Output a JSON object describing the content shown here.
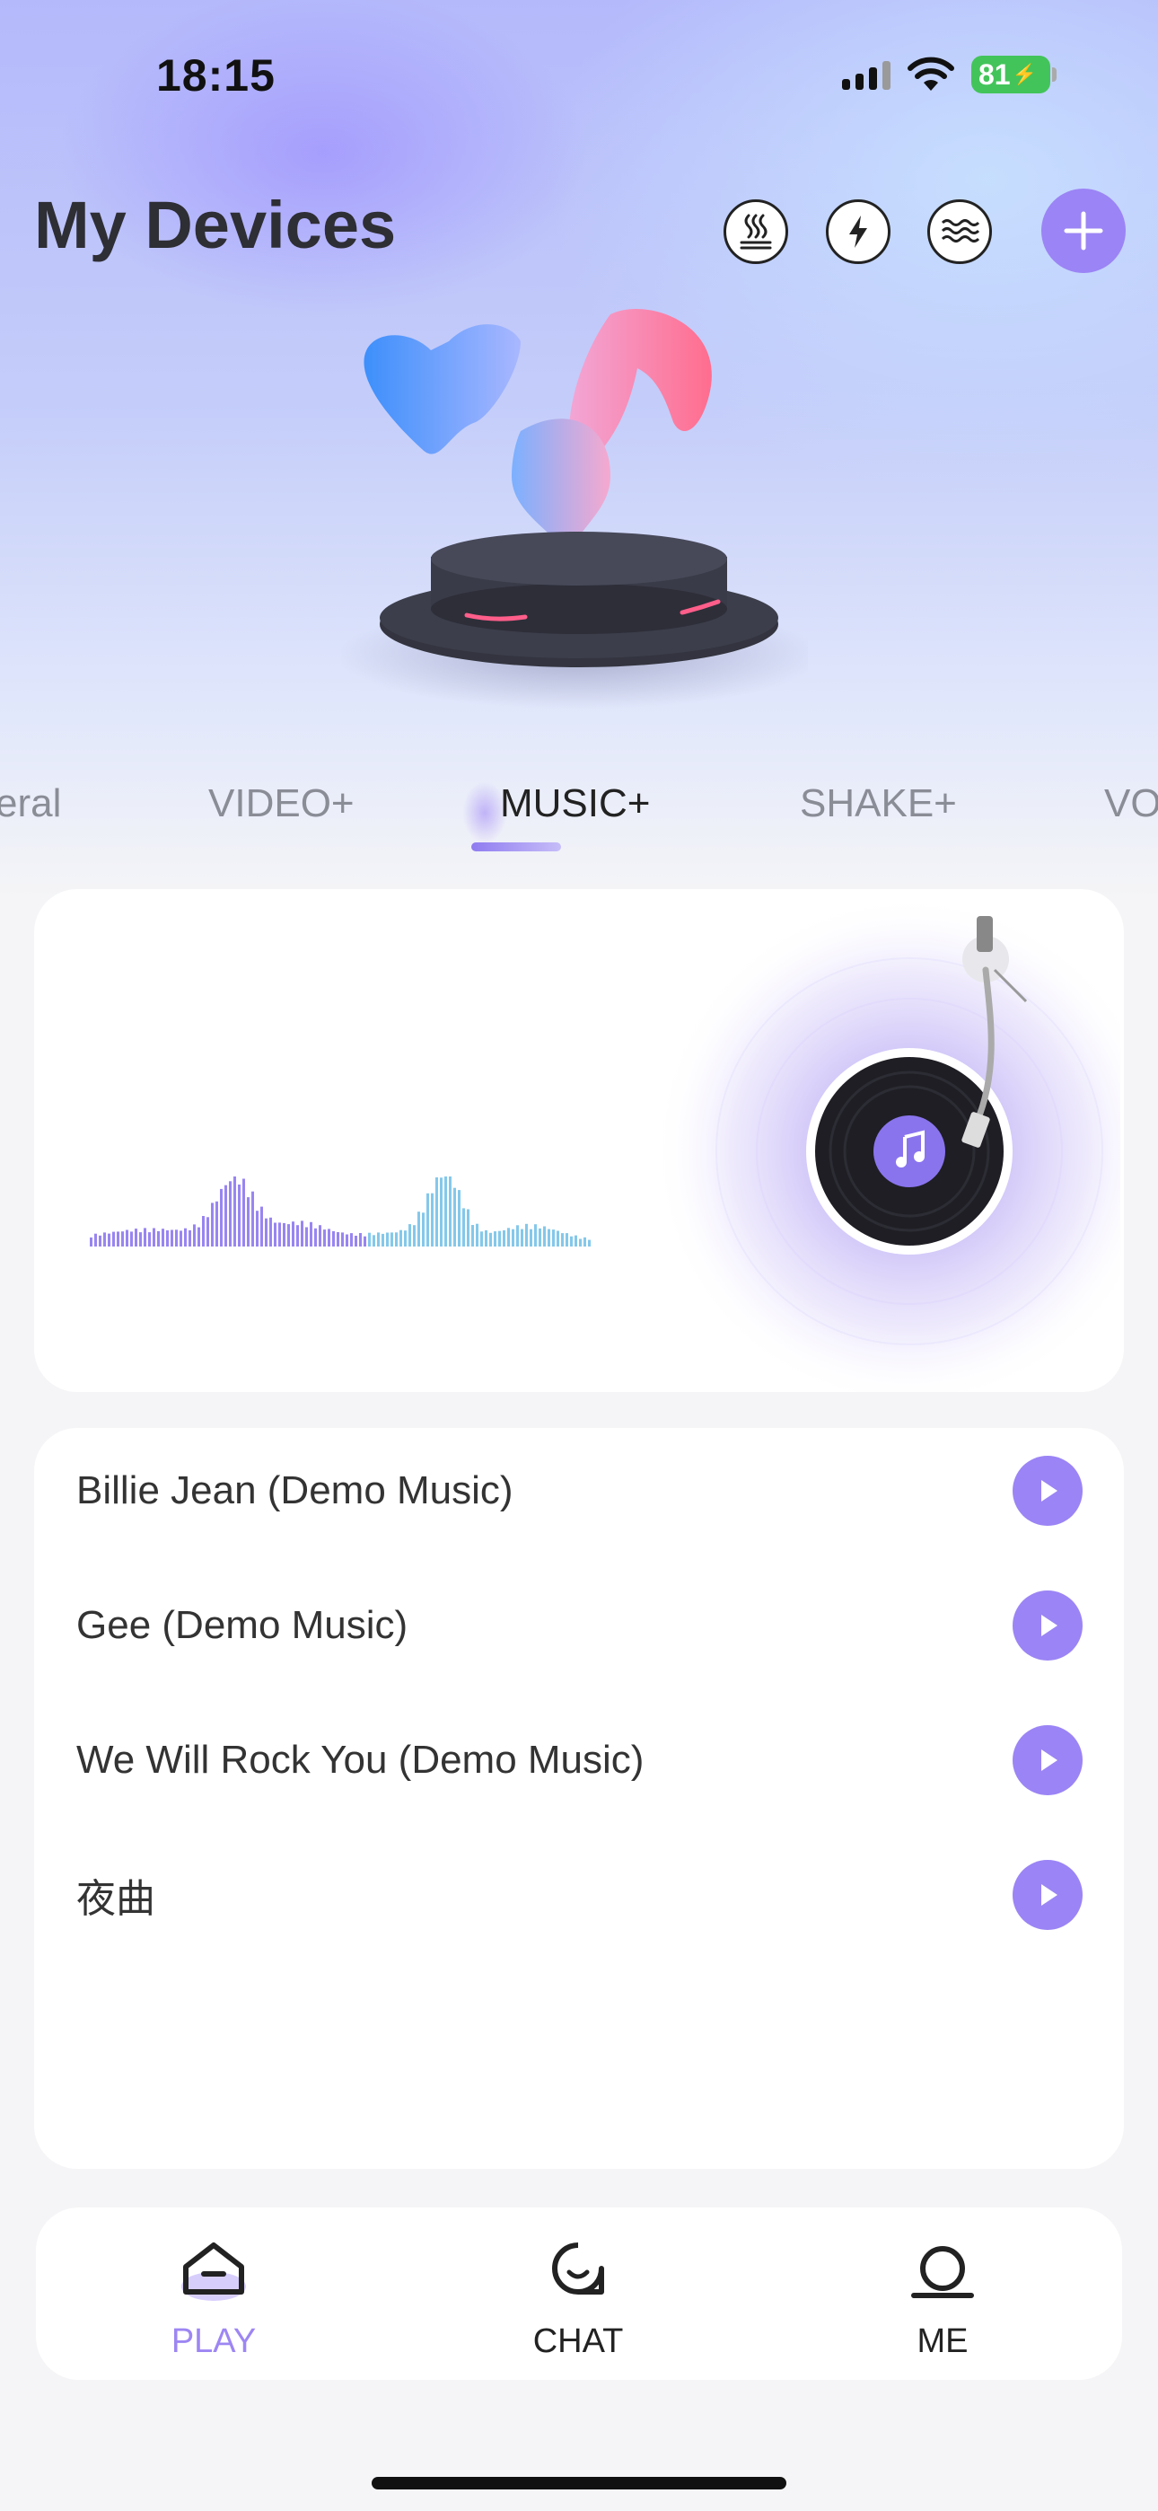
{
  "status_bar": {
    "time": "18:15",
    "battery": "81"
  },
  "header": {
    "title": "My Devices",
    "mode_icons": [
      "heat-icon",
      "lightning-icon",
      "waves-icon"
    ],
    "add_icon": "plus-icon"
  },
  "tabs": [
    {
      "label": "eral",
      "active": false
    },
    {
      "label": "VIDEO+",
      "active": false
    },
    {
      "label": "MUSIC+",
      "active": true
    },
    {
      "label": "SHAKE+",
      "active": false
    },
    {
      "label": "VO",
      "active": false
    }
  ],
  "songs": [
    {
      "title": "Billie Jean (Demo Music)"
    },
    {
      "title": "Gee (Demo Music)"
    },
    {
      "title": "We Will Rock You (Demo Music)"
    },
    {
      "title": "夜曲"
    }
  ],
  "bottom_nav": [
    {
      "label": "PLAY",
      "icon": "play-home-icon",
      "active": true
    },
    {
      "label": "CHAT",
      "icon": "chat-icon",
      "active": false
    },
    {
      "label": "ME",
      "icon": "profile-icon",
      "active": false
    }
  ],
  "colors": {
    "accent": "#9b84f5",
    "active_nav": "#9d86f3",
    "battery": "#43c45a"
  }
}
